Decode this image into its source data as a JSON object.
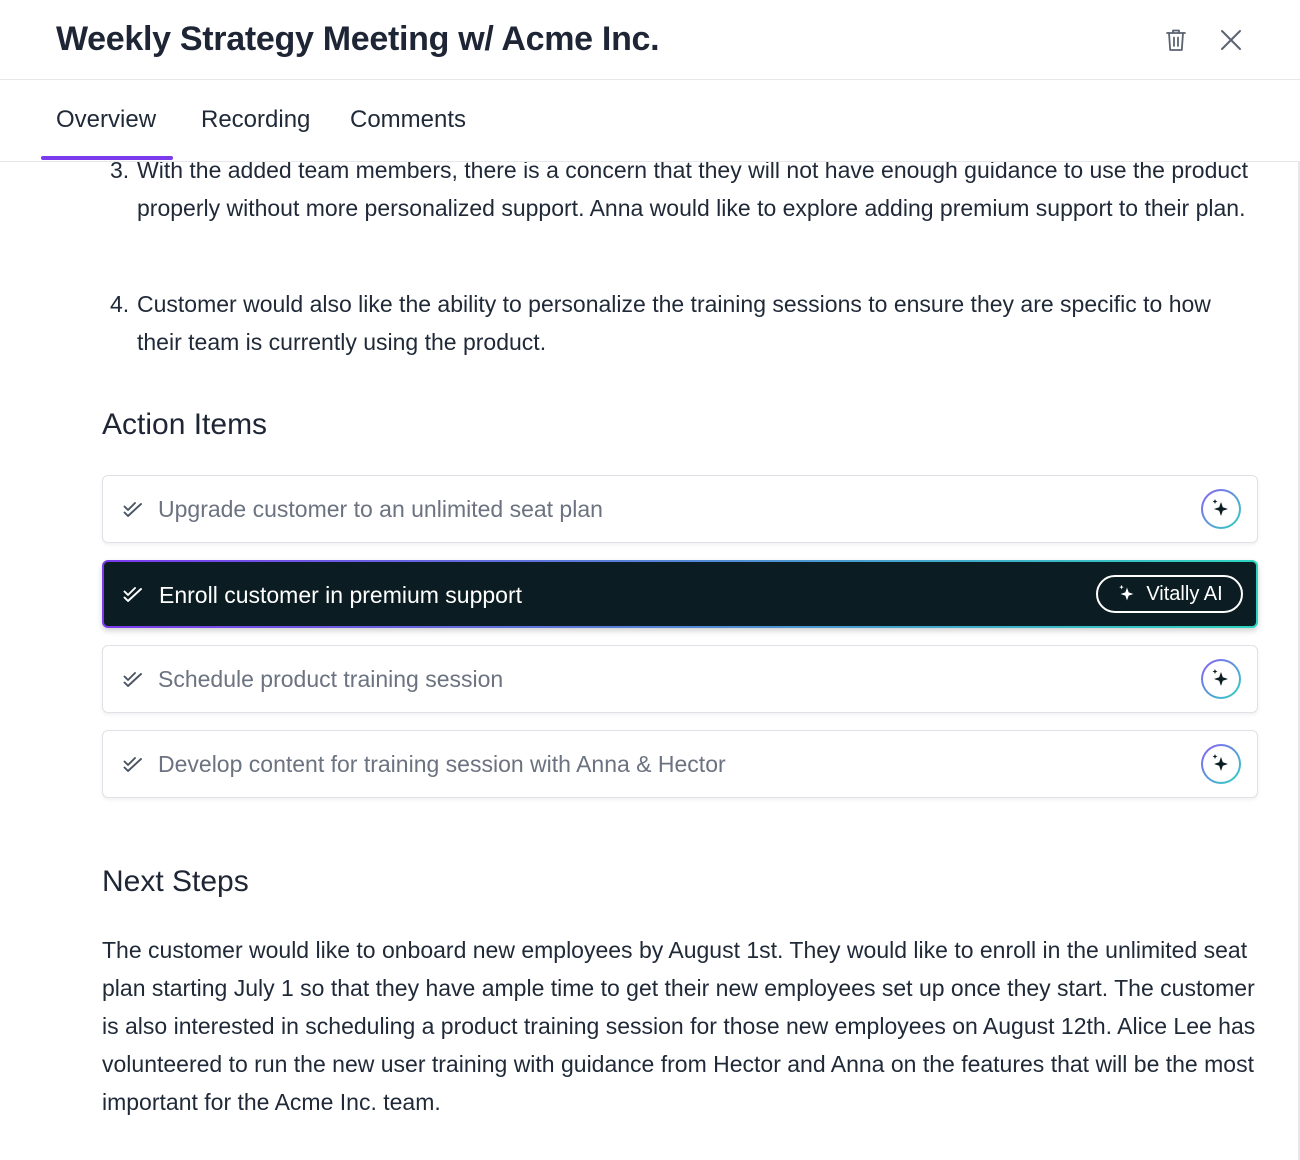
{
  "header": {
    "title": "Weekly Strategy Meeting w/ Acme Inc."
  },
  "tabs": [
    {
      "label": "Overview",
      "active": true
    },
    {
      "label": "Recording",
      "active": false
    },
    {
      "label": "Comments",
      "active": false
    }
  ],
  "discussion": {
    "items": [
      {
        "number": "3.",
        "text": "With the added team members, there is a concern that they will not have enough guidance to use the product properly without more personalized support. Anna would like to explore adding premium support to their plan."
      },
      {
        "number": "4.",
        "text": "Customer would also like the ability to personalize the training sessions to ensure they are specific to how their team is currently using the product."
      }
    ]
  },
  "action_items": {
    "title": "Action Items",
    "items": [
      {
        "label": "Upgrade customer to an unlimited seat plan",
        "active": false
      },
      {
        "label": "Enroll customer in premium support",
        "active": true,
        "ai_label": "Vitally AI"
      },
      {
        "label": "Schedule product training session",
        "active": false
      },
      {
        "label": "Develop content for training session with Anna & Hector",
        "active": false
      }
    ]
  },
  "next_steps": {
    "title": "Next Steps",
    "text": "The customer would like to onboard new employees by August 1st. They would like to enroll in the unlimited seat plan starting July 1 so that they have ample time to get their new employees set up once they start. The customer is also interested in scheduling a product training session for those new employees on August 12th. Alice Lee has volunteered to run the new user training with guidance from Hector and Anna on the features that will be the most important for the Acme Inc. team."
  },
  "colors": {
    "accent": "#7c3aed",
    "active_item_bg": "#0b1d22",
    "ai_gradient_start": "#8b5cf6",
    "ai_gradient_end": "#2dd4bf"
  }
}
